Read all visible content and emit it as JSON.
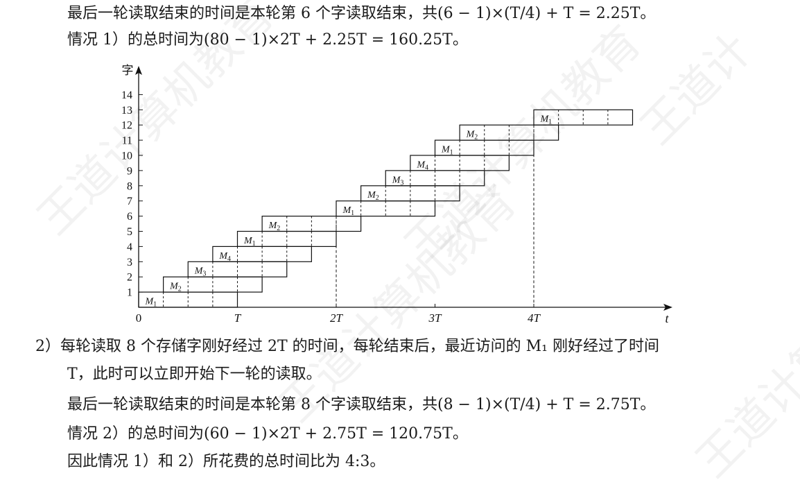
{
  "text": {
    "line1": "最后一轮读取结束的时间是本轮第 6 个字读取结束，共(6 − 1)×(T/4) + T = 2.25T。",
    "line2": "情况 1）的总时间为(80 − 1)×2T + 2.25T = 160.25T。",
    "line3": "2）每轮读取 8 个存储字刚好经过 2T 的时间，每轮结束后，最近访问的 M₁ 刚好经过了时间",
    "line4": "T，此时可以立即开始下一轮的读取。",
    "line5": "最后一轮读取结束的时间是本轮第 8 个字读取结束，共(8 − 1)×(T/4) + T = 2.75T。",
    "line6": "情况 2）的总时间为(60 − 1)×2T + 2.75T = 120.75T。",
    "line7": "因此情况 1）和 2）所花费的总时间比为 4:3。"
  },
  "diagram": {
    "y_axis_label": "字",
    "x_axis_label": "t",
    "y_ticks": [
      1,
      2,
      3,
      4,
      5,
      6,
      7,
      8,
      9,
      10,
      11,
      12,
      13,
      14
    ],
    "x_ticks": [
      {
        "label": "0",
        "t": 0
      },
      {
        "label": "T",
        "t": 1
      },
      {
        "label": "2T",
        "t": 2
      },
      {
        "label": "3T",
        "t": 3
      },
      {
        "label": "4T",
        "t": 4
      }
    ],
    "bars": [
      {
        "word": 1,
        "start": 0,
        "module": "M",
        "sub": "1"
      },
      {
        "word": 2,
        "start": 0.25,
        "module": "M",
        "sub": "2"
      },
      {
        "word": 3,
        "start": 0.5,
        "module": "M",
        "sub": "3"
      },
      {
        "word": 4,
        "start": 0.75,
        "module": "M",
        "sub": "4"
      },
      {
        "word": 5,
        "start": 1,
        "module": "M",
        "sub": "1"
      },
      {
        "word": 6,
        "start": 1.25,
        "module": "M",
        "sub": "2"
      },
      {
        "word": 7,
        "start": 2,
        "module": "M",
        "sub": "1"
      },
      {
        "word": 8,
        "start": 2.25,
        "module": "M",
        "sub": "2"
      },
      {
        "word": 9,
        "start": 2.5,
        "module": "M",
        "sub": "3"
      },
      {
        "word": 10,
        "start": 2.75,
        "module": "M",
        "sub": "4"
      },
      {
        "word": 11,
        "start": 3,
        "module": "M",
        "sub": "1"
      },
      {
        "word": 12,
        "start": 3.25,
        "module": "M",
        "sub": "2"
      },
      {
        "word": 13,
        "start": 4,
        "module": "M",
        "sub": "1"
      }
    ],
    "bar_duration": 1,
    "dashed_guides_t": [
      2,
      4
    ]
  },
  "watermark": [
    "王道计算机教育",
    "王道计算机教育",
    "王道计",
    "王道计算机教育",
    "王道计算机教育"
  ]
}
